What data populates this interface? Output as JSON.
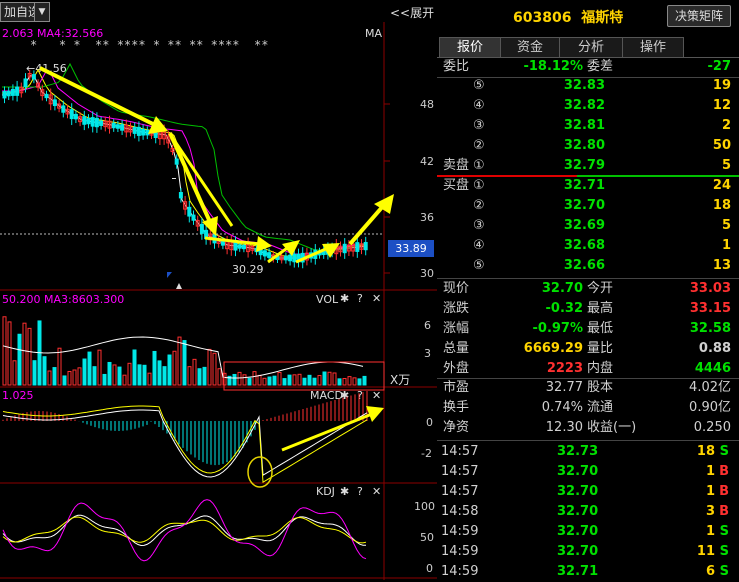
{
  "toolbar": {
    "add_watch_label": "加自选",
    "expand_label": "<<展开",
    "dropdown_glyph": "▼"
  },
  "price_panel": {
    "info_text": "2.063   MA4:32.566",
    "type_label": "MA",
    "star_marks": "*   * *  ** **** * ** ** ****  **",
    "y_ticks": [
      "48",
      "42",
      "36",
      "30"
    ],
    "current_price": "33.89",
    "high_label": "←41.56",
    "low_label": "30.29"
  },
  "vol_panel": {
    "info_text": "50.200  MA3:8603.300",
    "name": "VOL",
    "y_ticks": [
      "6",
      "3"
    ],
    "unit_label": "X万"
  },
  "macd_panel": {
    "info_text": "1.025",
    "name": "MACD",
    "y_ticks": [
      "0",
      "-2"
    ]
  },
  "kdj_panel": {
    "name": "KDJ",
    "y_ticks": [
      "100",
      "50",
      "0"
    ]
  },
  "panel_icons": {
    "gear": "✱",
    "help": "?",
    "close": "✕"
  },
  "stock": {
    "code_name": "603806  福斯特",
    "decision_button": "决策矩阵"
  },
  "tabs": [
    {
      "label": "报价",
      "active": true
    },
    {
      "label": "资金",
      "active": false
    },
    {
      "label": "分析",
      "active": false
    },
    {
      "label": "操作",
      "active": false
    }
  ],
  "ratio": {
    "weibi_label": "委比",
    "weibi_value": "-18.12%",
    "weicha_label": "委差",
    "weicha_value": "-27"
  },
  "asks": [
    {
      "label": "",
      "idx": "⑤",
      "price": "32.83",
      "vol": "19"
    },
    {
      "label": "",
      "idx": "④",
      "price": "32.82",
      "vol": "12"
    },
    {
      "label": "",
      "idx": "③",
      "price": "32.81",
      "vol": "2"
    },
    {
      "label": "",
      "idx": "②",
      "price": "32.80",
      "vol": "50"
    },
    {
      "label": "卖盘",
      "idx": "①",
      "price": "32.79",
      "vol": "5"
    }
  ],
  "bids": [
    {
      "label": "买盘",
      "idx": "①",
      "price": "32.71",
      "vol": "24"
    },
    {
      "label": "",
      "idx": "②",
      "price": "32.70",
      "vol": "18"
    },
    {
      "label": "",
      "idx": "③",
      "price": "32.69",
      "vol": "5"
    },
    {
      "label": "",
      "idx": "④",
      "price": "32.68",
      "vol": "1"
    },
    {
      "label": "",
      "idx": "⑤",
      "price": "32.66",
      "vol": "13"
    }
  ],
  "quote": [
    {
      "l1": "现价",
      "v1": "32.70",
      "c1": "#00e000",
      "l2": "今开",
      "v2": "33.03",
      "c2": "#ff3030"
    },
    {
      "l1": "涨跌",
      "v1": "-0.32",
      "c1": "#00e000",
      "l2": "最高",
      "v2": "33.15",
      "c2": "#ff3030"
    },
    {
      "l1": "涨幅",
      "v1": "-0.97%",
      "c1": "#00e000",
      "l2": "最低",
      "v2": "32.58",
      "c2": "#00e000"
    },
    {
      "l1": "总量",
      "v1": "6669.29",
      "c1": "#ffd400",
      "l2": "量比",
      "v2": "0.88",
      "c2": "#d0d0d0"
    },
    {
      "l1": "外盘",
      "v1": "2223",
      "c1": "#ff3030",
      "l2": "内盘",
      "v2": "4446",
      "c2": "#00e000"
    }
  ],
  "fund": [
    {
      "l1": "市盈",
      "v1": "32.77",
      "l2": "股本",
      "v2": "4.02亿"
    },
    {
      "l1": "换手",
      "v1": "0.74%",
      "l2": "流通",
      "v2": "0.90亿"
    },
    {
      "l1": "净资",
      "v1": "12.30",
      "l2": "收益(一)",
      "v2": "0.250"
    }
  ],
  "trades": [
    {
      "time": "14:57",
      "price": "32.73",
      "vol": "18",
      "side": "S"
    },
    {
      "time": "14:57",
      "price": "32.70",
      "vol": "1",
      "side": "B"
    },
    {
      "time": "14:57",
      "price": "32.70",
      "vol": "1",
      "side": "B"
    },
    {
      "time": "14:58",
      "price": "32.70",
      "vol": "3",
      "side": "B"
    },
    {
      "time": "14:59",
      "price": "32.70",
      "vol": "1",
      "side": "S"
    },
    {
      "time": "14:59",
      "price": "32.70",
      "vol": "11",
      "side": "S"
    },
    {
      "time": "14:59",
      "price": "32.71",
      "vol": "6",
      "side": "S"
    }
  ],
  "colors": {
    "up": "#ff3030",
    "down": "#00e8e8",
    "green": "#00e000",
    "yellow": "#ffd400",
    "ma_white": "#ffffff",
    "ma_yellow": "#ffff00",
    "ma_magenta": "#ff00ff",
    "ma_green": "#00c000"
  }
}
